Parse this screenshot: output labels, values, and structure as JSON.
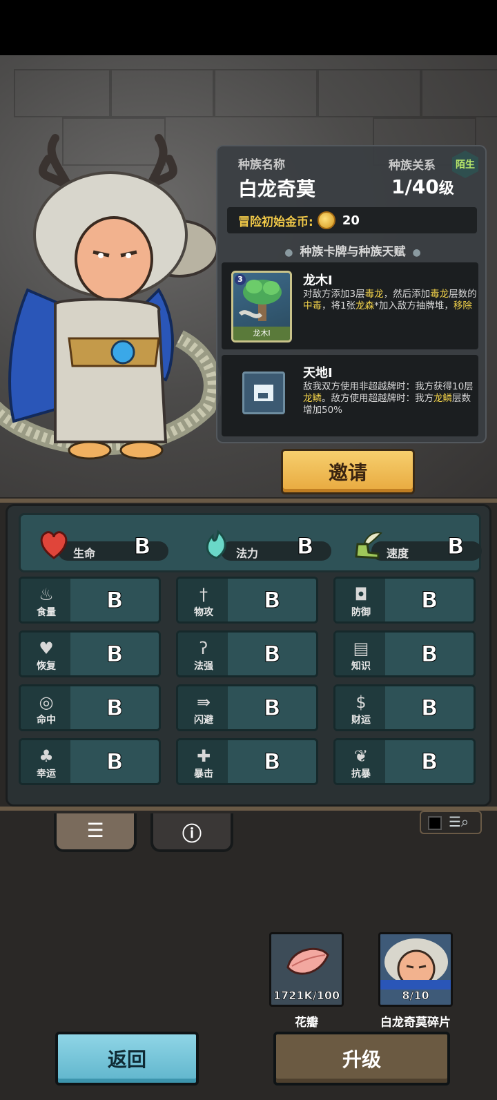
{
  "race": {
    "name_label": "种族名称",
    "name": "白龙奇莫",
    "relation_label": "种族关系",
    "relation_badge": "陌生",
    "level": "1/40",
    "level_suffix": "级",
    "gold_label": "冒险初始金币:",
    "gold_value": "20",
    "section_title": "种族卡牌与种族天赋"
  },
  "cards": [
    {
      "cost": "3",
      "caption": "龙木I",
      "title": "龙木I",
      "desc_parts": [
        "对敌方添加3层",
        "毒龙",
        "，然后添加",
        "毒龙",
        "层数的",
        "中毒",
        "，将1张",
        "龙森",
        "*加入敌方抽牌堆，",
        "移除"
      ]
    },
    {
      "title": "天地I",
      "desc_parts": [
        "敌我双方使用非超越牌时：我方获得10层",
        "龙鳞",
        "。敌方使用超越牌时：我方",
        "龙鳞",
        "层数增加50%"
      ]
    }
  ],
  "invite_button": "邀请",
  "main_stats": [
    {
      "name": "生命",
      "grade": "B",
      "icon": "heart-icon",
      "color": "#e0453a"
    },
    {
      "name": "法力",
      "grade": "B",
      "icon": "flame-icon",
      "color": "#6ad8c8"
    },
    {
      "name": "速度",
      "grade": "B",
      "icon": "winged-boot-icon",
      "color": "#9fc85a"
    }
  ],
  "stats": [
    {
      "name": "食量",
      "grade": "B",
      "icon": "stomach-icon",
      "glyph": "♨"
    },
    {
      "name": "物攻",
      "grade": "B",
      "icon": "sword-icon",
      "glyph": "†"
    },
    {
      "name": "防御",
      "grade": "B",
      "icon": "armor-icon",
      "glyph": "◘"
    },
    {
      "name": "恢复",
      "grade": "B",
      "icon": "heart-plus-icon",
      "glyph": "♥"
    },
    {
      "name": "法强",
      "grade": "B",
      "icon": "staff-icon",
      "glyph": "ʔ"
    },
    {
      "name": "知识",
      "grade": "B",
      "icon": "book-icon",
      "glyph": "▤"
    },
    {
      "name": "命中",
      "grade": "B",
      "icon": "target-icon",
      "glyph": "◎"
    },
    {
      "name": "闪避",
      "grade": "B",
      "icon": "dash-arrow-icon",
      "glyph": "⇛"
    },
    {
      "name": "财运",
      "grade": "B",
      "icon": "coin-dollar-icon",
      "glyph": "$"
    },
    {
      "name": "幸运",
      "grade": "B",
      "icon": "clover-icon",
      "glyph": "♣"
    },
    {
      "name": "暴击",
      "grade": "B",
      "icon": "crit-icon",
      "glyph": "✚"
    },
    {
      "name": "抗暴",
      "grade": "B",
      "icon": "shield-flower-icon",
      "glyph": "❦"
    }
  ],
  "tabs": [
    {
      "name": "list-tab",
      "glyph": "☰",
      "active": true
    },
    {
      "name": "info-tab",
      "glyph": "ⓘ",
      "active": false
    }
  ],
  "items": [
    {
      "name": "花瓣",
      "count": "1721K/100",
      "icon": "petal-icon"
    },
    {
      "name": "白龙奇莫碎片",
      "count": "8/10",
      "icon": "character-shard-icon"
    }
  ],
  "back_button": "返回",
  "upgrade_button": "升级"
}
